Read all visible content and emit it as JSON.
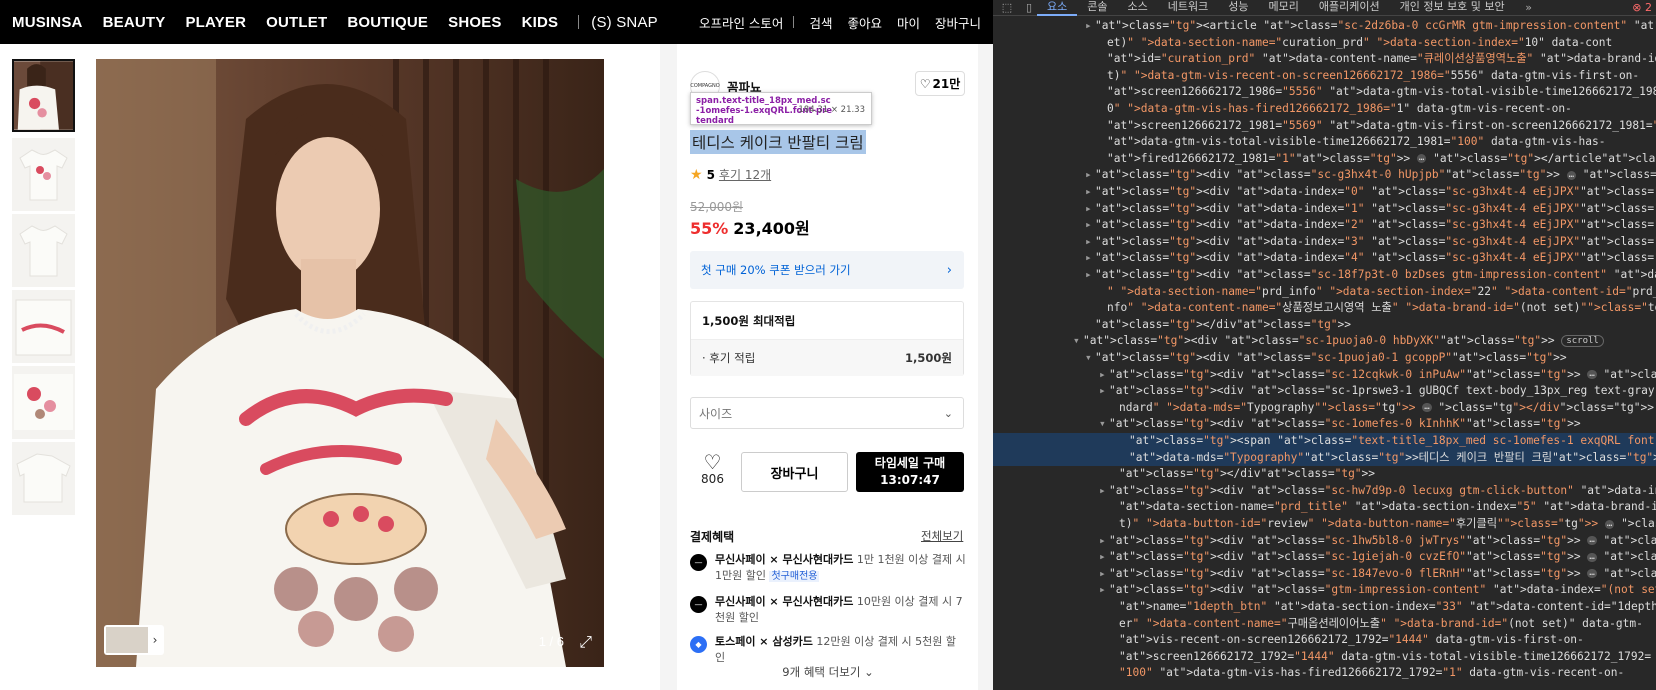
{
  "nav": {
    "left": [
      "MUSINSA",
      "BEAUTY",
      "PLAYER",
      "OUTLET",
      "BOUTIQUE",
      "SHOES",
      "KIDS"
    ],
    "snap": "(S) SNAP",
    "right": [
      "오프라인 스토어",
      "검색",
      "좋아요",
      "마이",
      "장바구니"
    ]
  },
  "gallery": {
    "counter": "1 / 6",
    "expand_icon": "expand-icon"
  },
  "product": {
    "brand": "꼼파뇨",
    "brand_logo_text": "COMPAGNO",
    "like_count": "21만",
    "title": "테디스 케이크 반팔티 크림",
    "rating": "5",
    "review_link": "후기 12개",
    "original_price": "52,000원",
    "discount": "55%",
    "sale_price": "23,400원",
    "coupon": "첫 구매 20% 쿠폰 받으러 가기",
    "points_header": "1,500원 최대적립",
    "points_row_label": "· 후기 적립",
    "points_row_value": "1,500원",
    "size_placeholder": "사이즈",
    "like_bottom_count": "806",
    "cart_button": "장바구니",
    "buy_button": "타임세일 구매",
    "buy_timer": "13:07:47",
    "benefits_header": "결제혜택",
    "benefits_all": "전체보기",
    "benefits": [
      {
        "brand": "무신사페이 × 무신사현대카드",
        "text": " 1만 1천원 이상 결제 시 1만원 할인 ",
        "tag": "첫구매전용"
      },
      {
        "brand": "무신사페이 × 무신사현대카드",
        "text": " 10만원 이상 결제 시 7천원 할인",
        "tag": ""
      },
      {
        "brand": "토스페이 × 삼성카드",
        "text": " 12만원 이상 결제 시 5천원 할인",
        "tag": ""
      }
    ],
    "more_benefits": "9개 혜택 더보기"
  },
  "tooltip": {
    "line1": "span.text-title_18px_med.sc",
    "line2": "-1omefes-1.exqQRL.font-pre",
    "line3": "tendard",
    "dims": "184.31 × 21.33"
  },
  "devtools": {
    "tabs": [
      "요소",
      "콘솔",
      "소스",
      "네트워크",
      "성능",
      "메모리",
      "애플리케이션",
      "개인 정보 보호 및 보안"
    ],
    "error_count": "2",
    "lines": [
      "<article class=\"sc-2dz6ba-0 ccGrMR gtm-impression-content\" data-index=\"(not s",
      "et)\" data-section-name=\"curation_prd\" data-section-index=\"10\" data-cont",
      "id=\"curation_prd\" data-content-name=\"큐레이션상품영역노출\" data-brand-id=\"(not se",
      "t)\" data-gtm-vis-recent-on-screen126662172_1986=\"5556\" data-gtm-vis-first-on-",
      "screen126662172_1986=\"5556\" data-gtm-vis-total-visible-time126662172_1986=\"10",
      "0\" data-gtm-vis-has-fired126662172_1986=\"1\" data-gtm-vis-recent-on-",
      "screen126662172_1981=\"5569\" data-gtm-vis-first-on-screen126662172_1981=\"5569\"",
      "data-gtm-vis-total-visible-time126662172_1981=\"100\" data-gtm-vis-has-",
      "fired126662172_1981=\"1\"> … </article>",
      "<div class=\"sc-g3hx4t-0 hUpjpb\"> … </div>",
      "<div data-index=\"0\" class=\"sc-g3hx4t-4 eEjJPX\"> … </div>",
      "<div data-index=\"1\" class=\"sc-g3hx4t-4 eEjJPX\"> … </div>",
      "<div data-index=\"2\" class=\"sc-g3hx4t-4 eEjJPX\"> … </div>",
      "<div data-index=\"3\" class=\"sc-g3hx4t-4 eEjJPX\"> … </div>",
      "<div data-index=\"4\" class=\"sc-g3hx4t-4 eEjJPX\"> … </div>",
      "<div class=\"sc-18f7p3t-0 bzDses gtm-impression-content\" data-index=\"(not set)",
      "\" data-section-name=\"prd_info\" data-section-index=\"22\" data-content-id=\"prd_i",
      "nfo\" data-content-name=\"상품정보고시영역 노출\" data-brand-id=\"(not set)\"> … </div>",
      "</div>",
      "<div class=\"sc-1puoja0-0 hbDyXK\"> scroll",
      "<div class=\"sc-1puoja0-1 gcoppP\">",
      "<div class=\"sc-12cqkwk-0 inPuAw\"> … </div> flex",
      "<div class=\"sc-1prswe3-1 gUBQCf text-body_13px_reg text-gray-600 font-prete",
      "ndard\" data-mds=\"Typography\"> … </div> flex",
      "<div class=\"sc-1omefes-0 kInhhK\">",
      "<span class=\"text-title_18px_med sc-1omefes-1 exqQRL font-pretendard\"",
      "data-mds=\"Typography\">테디스 케이크 반팔티 크림</span> == $0",
      "</div>",
      "<div class=\"sc-hw7d9p-0 lecuxg gtm-click-button\" data-index=\"(not set)\"",
      "data-section-name=\"prd_title\" data-section-index=\"5\" data-brand-id=\"(not se",
      "t)\" data-button-id=\"review\" data-button-name=\"후기클릭\"> … </div> flex",
      "<div class=\"sc-1hw5bl8-0 jwTrys\"> … </div> flex",
      "<div class=\"sc-1giejah-0 cvzEfO\"> … </div> flex",
      "<div class=\"sc-1847evo-0 flERnH\"> … </div> flex",
      "<div class=\"gtm-impression-content\" data-index=\"(not set)\" data-section-",
      "name=\"1depth_btn\" data-section-index=\"33\" data-content-id=\"1depth_optionlay",
      "er\" data-content-name=\"구매옵션레이어노출\" data-brand-id=\"(not set)\" data-gtm-",
      "vis-recent-on-screen126662172_1792=\"1444\" data-gtm-vis-first-on-",
      "screen126662172_1792=\"1444\" data-gtm-vis-total-visible-time126662172_1792=",
      "\"100\" data-gtm-vis-has-fired126662172_1792=\"1\" data-gtm-vis-recent-on-"
    ]
  }
}
